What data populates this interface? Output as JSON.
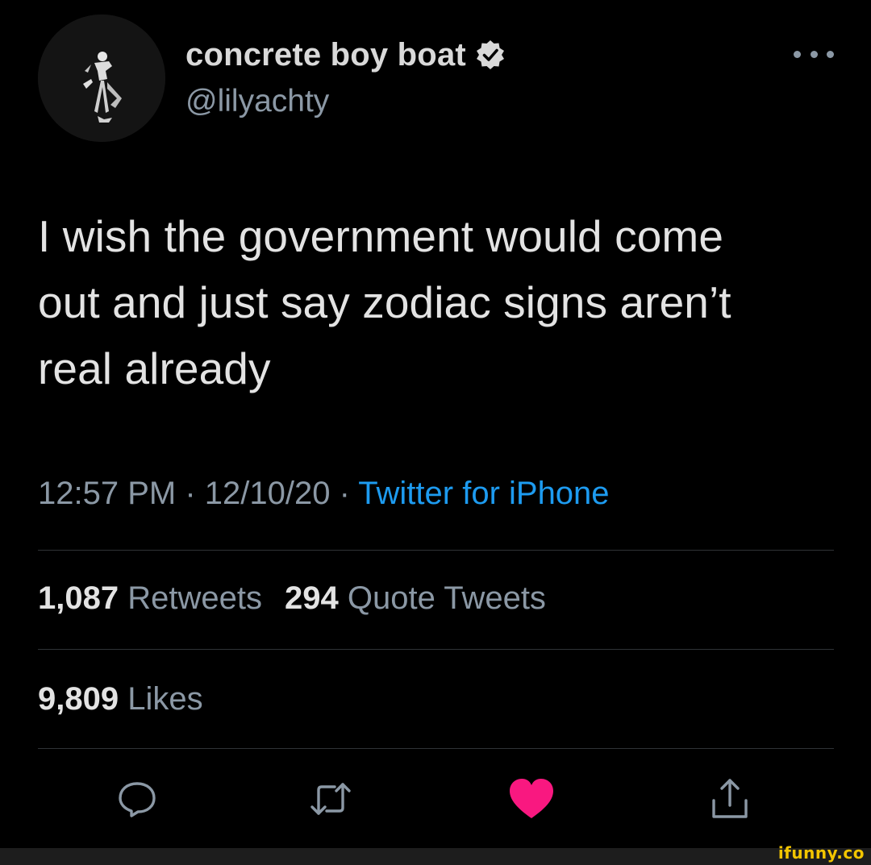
{
  "author": {
    "display_name": "concrete boy boat",
    "handle": "@lilyachty",
    "verified": true,
    "avatar": "avatar-photo"
  },
  "tweet": {
    "lines": [
      "I wish the government would come",
      "out and just say zodiac signs aren’t",
      "real already"
    ]
  },
  "meta": {
    "time": "12:57 PM",
    "separator": " · ",
    "date": "12/10/20",
    "source": "Twitter for iPhone"
  },
  "stats": {
    "retweets_count": "1,087",
    "retweets_label": "Retweets",
    "quotes_count": "294",
    "quotes_label": "Quote Tweets",
    "likes_count": "9,809",
    "likes_label": "Likes"
  },
  "actions": [
    {
      "icon": "reply-icon"
    },
    {
      "icon": "retweet-icon"
    },
    {
      "icon": "heart-icon",
      "active": true
    },
    {
      "icon": "share-icon"
    }
  ],
  "colors": {
    "background": "#000000",
    "text": "#e3e3e3",
    "secondary": "#8b98a5",
    "link": "#1d9bf0",
    "like": "#f91880",
    "divider": "#2f3336"
  },
  "watermark": "ifunny.co"
}
